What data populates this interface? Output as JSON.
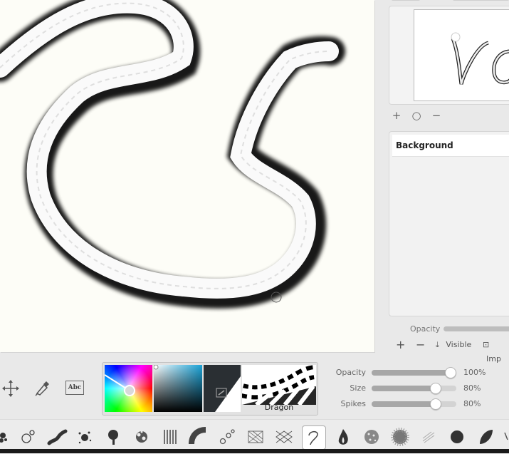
{
  "navigator": {
    "controls": [
      {
        "name": "zoom-in",
        "glyph": "+"
      },
      {
        "name": "zoom-reset",
        "glyph": "○"
      },
      {
        "name": "zoom-out",
        "glyph": "−"
      }
    ]
  },
  "layers": {
    "items": [
      {
        "name": "Background"
      }
    ],
    "opacity_label": "Opacity",
    "controls": {
      "add": "+",
      "remove": "−",
      "visible": "Visible",
      "import": "Imp"
    }
  },
  "tools": [
    "move-tool",
    "eyedropper-tool",
    "text-tool"
  ],
  "text_tool_glyph": "Abc",
  "brush": {
    "name": "Dragon",
    "active_color": "#1aa2d6"
  },
  "sliders": [
    {
      "label": "Opacity",
      "value": "100%",
      "level": 1.0
    },
    {
      "label": "Size",
      "value": "80%",
      "level": 0.8
    },
    {
      "label": "Spikes",
      "value": "80%",
      "level": 0.8
    }
  ],
  "brushes": [
    "blob-brush",
    "bubbles-brush",
    "stroke-brush",
    "splatter-brush",
    "drip-brush",
    "scatter-brush",
    "lines-brush",
    "fan-brush",
    "chain-brush",
    "hatch-brush",
    "cross-hatch-brush",
    "dragon-brush",
    "flame-brush",
    "sponge-brush",
    "noise-brush",
    "sketch-brush",
    "ink-blot-brush",
    "leaf-brush"
  ],
  "active_brush": "dragon-brush"
}
